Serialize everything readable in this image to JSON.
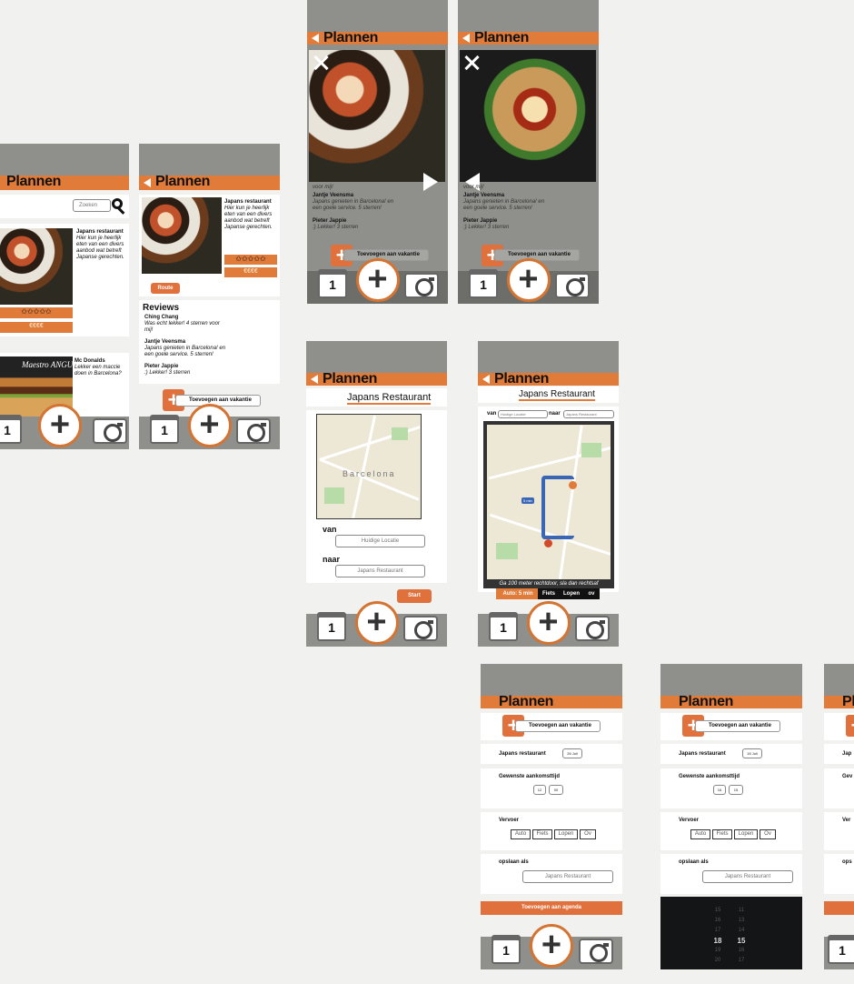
{
  "app_title": "Plannen",
  "search": {
    "placeholder": "Zoeken"
  },
  "screen_list": {
    "items": [
      {
        "name": "Japans restaurant",
        "desc": "Hier kun je heerlijk eten van een divers aanbod wat betreft Japanse gerechten.",
        "stars": "✩✩✩✩✩",
        "price": "€€€€"
      },
      {
        "name": "Mc Donalds",
        "desc": "Lekker een maccie doen in Barcelona?",
        "logo": "Maestro ANGUS"
      }
    ]
  },
  "screen_detail": {
    "name": "Japans restaurant",
    "desc": "Hier kun je heerlijk eten van een divers aanbod wat betreft Japanse gerechten.",
    "stars": "✩✩✩✩✩",
    "price": "€€€€",
    "route_button": "Route",
    "reviews_title": "Reviews",
    "reviews": [
      {
        "author": "Ching Chang",
        "text": "Was echt lekker! 4 sterren voor mij!"
      },
      {
        "author": "Jantje Veensma",
        "text": "Japans genieten in Barcelona! en een goele service. 5 sterren!"
      },
      {
        "author": "Pieter Jappie",
        "text": ":) Lekker! 3 sterren"
      }
    ],
    "add_button": "Toevoegen aan vakantie"
  },
  "screen_photo": {
    "caption_top": "voor mij!",
    "reviews": [
      {
        "author": "Jantje Veensma",
        "text": "Japans genieten in Barcelona! en een goele service. 5 sterren!"
      },
      {
        "author": "Pieter Jappie",
        "text": ":) Lekker! 3 sterren"
      }
    ],
    "add_button": "Toevoegen aan vakantie"
  },
  "screen_route": {
    "title": "Japans Restaurant",
    "map_city": "Barcelona",
    "from_label": "van",
    "from_value": "Huidige Locatie",
    "to_label": "naar",
    "to_value": "Japans Restaurant",
    "start_button": "Start"
  },
  "screen_nav": {
    "title": "Japans Restaurant",
    "from_label": "van",
    "from_value": "Huidige Locatie",
    "to_label": "naar",
    "to_value": "Japans Restaurant",
    "route_time": "5 min",
    "instruction": "Ga 100 meter rechtdoor, sla dan rechtsaf",
    "modes": [
      "Auto: 5 min",
      "Fiets",
      "Lopen",
      "ov"
    ]
  },
  "screen_plan": {
    "add_button": "Toevoegen aan vakantie",
    "place": "Japans restaurant",
    "date": "26 Juli",
    "date_b": "16 Juli",
    "arrival_label": "Gewenste aankomsttijd",
    "hour": "12",
    "minute": "00",
    "hour_b": "16",
    "minute_b": "15",
    "transport_label": "Vervoer",
    "transport": [
      "Auto",
      "Fiets",
      "Lopen",
      "Ov"
    ],
    "save_label": "opslaan als",
    "save_value": "Japans Restaurant",
    "agenda_button": "Toevoegen aan agenda",
    "picker_hours": [
      "15",
      "16",
      "17",
      "18",
      "19",
      "20"
    ],
    "picker_minutes": [
      "11",
      "13",
      "14",
      "15",
      "16",
      "17"
    ]
  },
  "screen_partial": {
    "title": "Pl",
    "label1": "Jap",
    "label2": "Gev",
    "label3": "Ver",
    "label4": "ops"
  },
  "footer": {
    "calendar_day": "1"
  },
  "colors": {
    "accent": "#e07b39",
    "header_grey": "#8f908c",
    "background": "#f1f1ef"
  }
}
